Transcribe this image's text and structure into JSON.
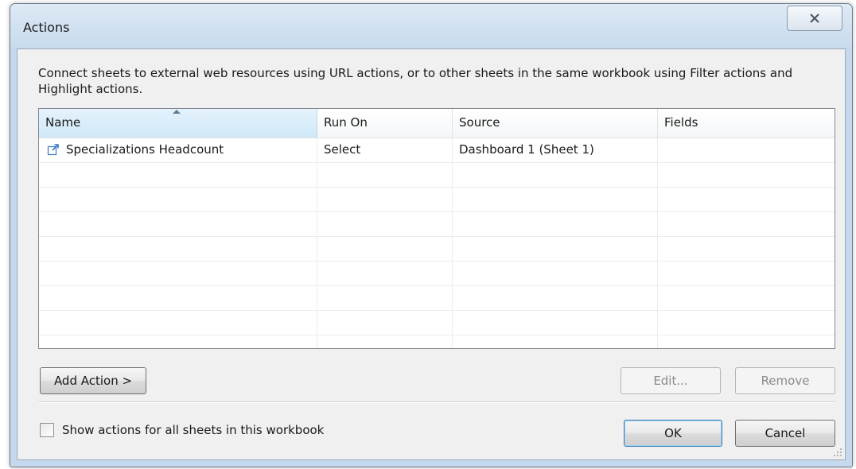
{
  "window": {
    "title": "Actions",
    "close_icon": "close-icon"
  },
  "description": "Connect sheets to external web resources using URL actions, or to other sheets in the same workbook using Filter actions and Highlight actions.",
  "table": {
    "columns": [
      "Name",
      "Run On",
      "Source",
      "Fields"
    ],
    "sorted_column": "Name",
    "sort_direction": "ascending",
    "rows": [
      {
        "icon": "url-action-icon",
        "name": "Specializations Headcount",
        "run_on": "Select",
        "source": "Dashboard 1 (Sheet 1)",
        "fields": ""
      }
    ]
  },
  "buttons": {
    "add_action": "Add Action >",
    "edit": "Edit...",
    "remove": "Remove",
    "ok": "OK",
    "cancel": "Cancel"
  },
  "show_all_checkbox": {
    "label": "Show actions for all sheets in this workbook",
    "checked": false
  }
}
